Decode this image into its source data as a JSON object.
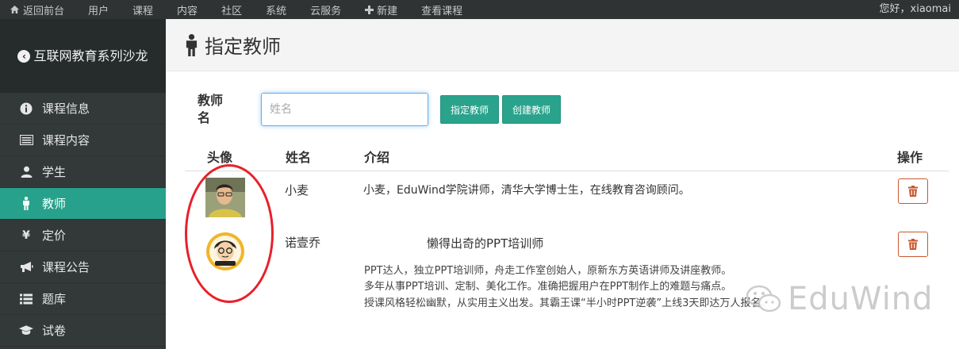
{
  "topbar": {
    "items": [
      {
        "label": "返回前台",
        "icon": "home-icon"
      },
      {
        "label": "用户"
      },
      {
        "label": "课程"
      },
      {
        "label": "内容"
      },
      {
        "label": "社区"
      },
      {
        "label": "系统"
      },
      {
        "label": "云服务"
      },
      {
        "label": "新建",
        "icon": "plus-icon"
      },
      {
        "label": "查看课程"
      }
    ],
    "greeting": "您好，xiaomai"
  },
  "sidebar": {
    "brand": "互联网教育系列沙龙",
    "items": [
      {
        "label": "课程信息",
        "icon": "info-icon"
      },
      {
        "label": "课程内容",
        "icon": "list-icon"
      },
      {
        "label": "学生",
        "icon": "user-icon"
      },
      {
        "label": "教师",
        "icon": "person-icon",
        "active": true
      },
      {
        "label": "定价",
        "icon": "yen-icon"
      },
      {
        "label": "课程公告",
        "icon": "bullhorn-icon"
      },
      {
        "label": "题库",
        "icon": "list-bullets-icon"
      },
      {
        "label": "试卷",
        "icon": "graduation-cap-icon"
      }
    ]
  },
  "page": {
    "title": "指定教师"
  },
  "form": {
    "label_line1": "教师",
    "label_line2": "名",
    "placeholder": "姓名",
    "assign_button": "指定教师",
    "create_button": "创建教师"
  },
  "table": {
    "headers": {
      "avatar": "头像",
      "name": "姓名",
      "intro": "介绍",
      "actions": "操作"
    },
    "rows": [
      {
        "name": "小麦",
        "intro_title": "小麦，EduWind学院讲师，清华大学博士生，在线教育咨询顾问。"
      },
      {
        "name": "诺壹乔",
        "intro_title": "懒得出奇的PPT培训师",
        "intro_lines": [
          "PPT达人，独立PPT培训师，舟走工作室创始人，原新东方英语讲师及讲座教师。",
          "多年从事PPT培训、定制、美化工作。准确把握用户在PPT制作上的难题与痛点。",
          "授课风格轻松幽默，从实用主义出发。其霸王课“半小时PPT逆袭”上线3天即达万人报名。"
        ]
      }
    ]
  },
  "watermark": "EduWind",
  "colors": {
    "accent": "#27a18b",
    "danger": "#c9572f",
    "annotation": "#e8202a"
  }
}
